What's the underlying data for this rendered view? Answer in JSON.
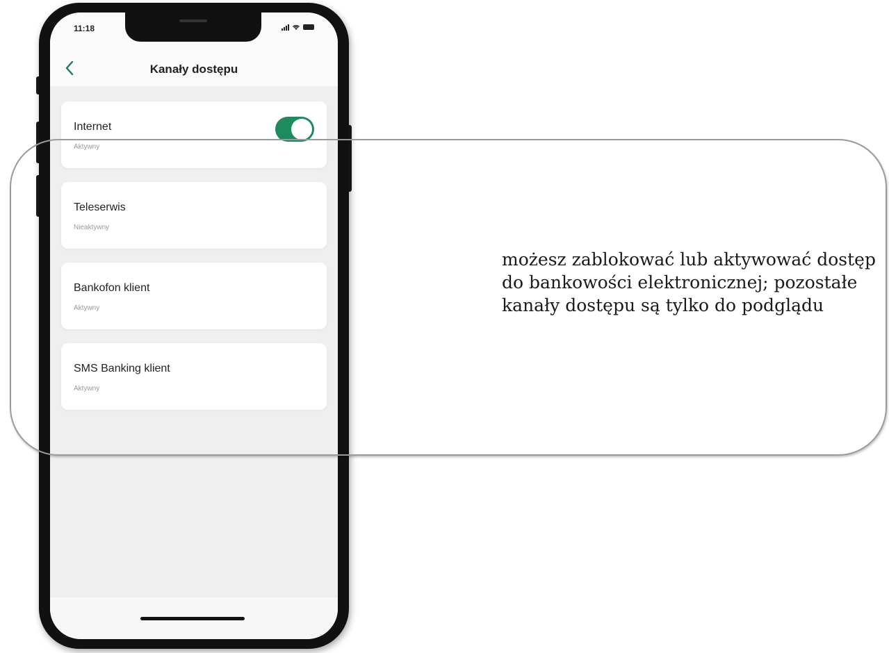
{
  "status_bar": {
    "time": "11:18"
  },
  "header": {
    "title": "Kanały dostępu"
  },
  "channels": [
    {
      "name": "Internet",
      "status": "Aktywny",
      "toggle": "on"
    },
    {
      "name": "Teleserwis",
      "status": "Nieaktywny"
    },
    {
      "name": "Bankofon klient",
      "status": "Aktywny"
    },
    {
      "name": "SMS Banking klient",
      "status": "Aktywny"
    }
  ],
  "annotation": "możesz zablokować lub aktywować dostęp do bankowości elektronicznej; pozostałe kanały dostępu są tylko do podglądu",
  "colors": {
    "accent": "#1e8a5e",
    "back_arrow": "#1d7a55"
  }
}
